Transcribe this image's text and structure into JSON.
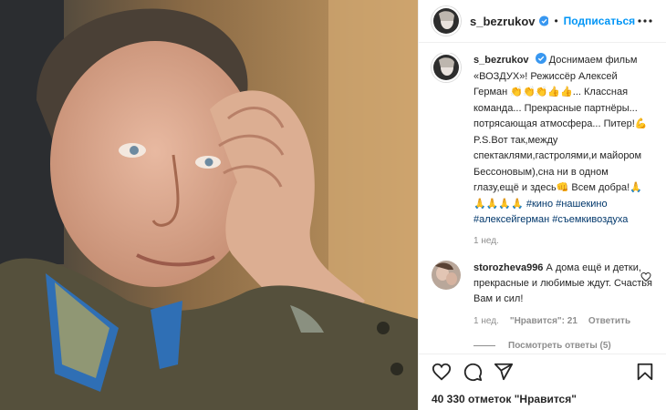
{
  "post": {
    "username": "s_bezrukov",
    "follow_label": "Подписаться",
    "dot": "•"
  },
  "caption": {
    "username": "s_bezrukov",
    "text_1": "Доснимаем фильм «ВОЗДУХ»! Режиссёр Алексей Герман ",
    "emoji_1": "👏👏👏👍👍",
    "text_2": "... Классная команда... Прекрасные партнёры... потрясающая атмосфера... Питер!",
    "emoji_2": "💪",
    "text_3": " P.S.Вот так,между спектаклями,гастролями,и майором Бессоновым),сна ни в одном глазу,ещё и здесь",
    "emoji_3": "👊",
    "text_4": " Всем добра!",
    "emoji_4": "🙏🙏🙏🙏🙏",
    "tags": [
      "#кино",
      "#нашекино",
      "#алексейгерман",
      "#съемкивоздуха"
    ],
    "time": "1 нед."
  },
  "comment": {
    "username": "storozheva996",
    "text": " А дома ещё и детки, прекрасные и любимые ждут. Счастья Вам и сил!",
    "time": "1 нед.",
    "likes": "\"Нравится\": 21",
    "reply": "Ответить",
    "view_replies": "Посмотреть ответы (5)"
  },
  "footer": {
    "likes": "40 330 отметок \"Нравится\""
  },
  "colors": {
    "accent": "#0095f6",
    "verified": "#3897f0",
    "muted": "#8e8e8e",
    "hashtag": "#00376b"
  },
  "icons": [
    "verified-icon",
    "more-icon",
    "heart-icon",
    "comment-icon",
    "share-icon",
    "bookmark-icon",
    "like-comment-icon"
  ]
}
